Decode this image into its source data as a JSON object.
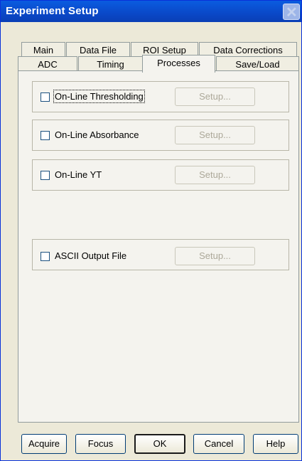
{
  "window": {
    "title": "Experiment Setup"
  },
  "tabs_row1": [
    "Main",
    "Data File",
    "ROI Setup",
    "Data Corrections"
  ],
  "tabs_row2": [
    "ADC",
    "Timing",
    "Processes",
    "Save/Load"
  ],
  "active_tab": "Processes",
  "processes": [
    {
      "label": "On-Line Thresholding",
      "checked": false,
      "setup_label": "Setup...",
      "setup_enabled": false
    },
    {
      "label": "On-Line Absorbance",
      "checked": false,
      "setup_label": "Setup...",
      "setup_enabled": false
    },
    {
      "label": "On-Line YT",
      "checked": false,
      "setup_label": "Setup...",
      "setup_enabled": false
    },
    {
      "label": "ASCII Output File",
      "checked": false,
      "setup_label": "Setup...",
      "setup_enabled": false
    }
  ],
  "buttons": {
    "acquire": "Acquire",
    "focus": "Focus",
    "ok": "OK",
    "cancel": "Cancel",
    "help": "Help"
  }
}
